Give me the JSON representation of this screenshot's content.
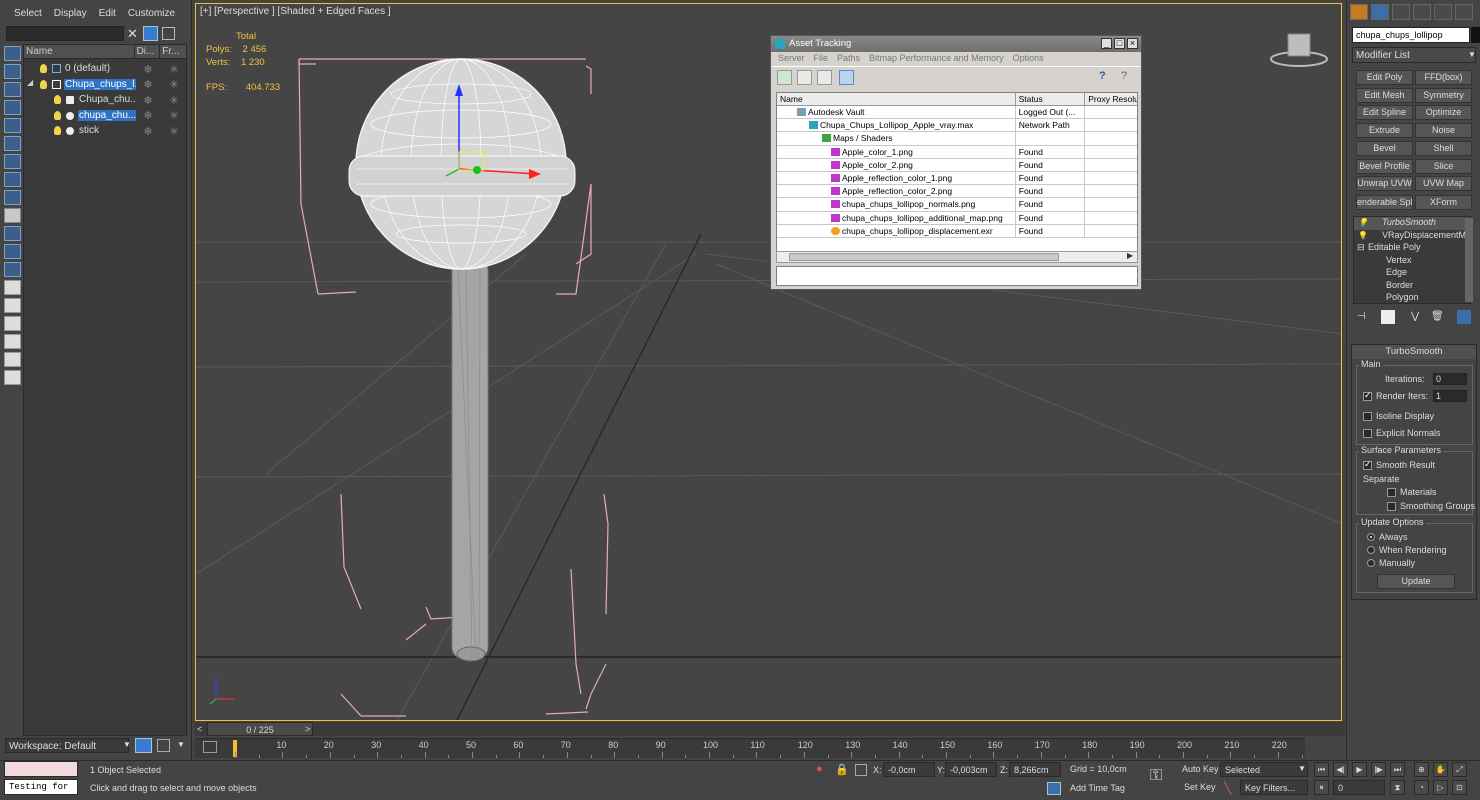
{
  "explorer": {
    "menu": [
      "Select",
      "Display",
      "Edit",
      "Customize"
    ],
    "columns": [
      "Name",
      "Di...",
      "Fr..."
    ],
    "rows": [
      {
        "label": "0 (default)",
        "level": 0
      },
      {
        "label": "Chupa_chups_l...",
        "level": 0,
        "selected": true
      },
      {
        "label": "Chupa_chu...",
        "level": 1
      },
      {
        "label": "chupa_chu...",
        "level": 1,
        "selected": true
      },
      {
        "label": "stick",
        "level": 1
      }
    ],
    "workspace": "Workspace: Default"
  },
  "viewport": {
    "label": "[+] [Perspective ] [Shaded + Edged Faces ]",
    "stats": {
      "total_label": "Total",
      "polys_label": "Polys:",
      "polys": "2 456",
      "verts_label": "Verts:",
      "verts": "1 230",
      "fps_label": "FPS:",
      "fps": "404.733"
    }
  },
  "asset_tracking": {
    "title": "Asset Tracking",
    "menu": [
      "Server",
      "File",
      "Paths",
      "Bitmap Performance and Memory",
      "Options"
    ],
    "columns": [
      "Name",
      "Status",
      "Proxy Resolu"
    ],
    "rows": [
      {
        "name": "Autodesk Vault",
        "status": "Logged Out (...",
        "icon": "vault-icon",
        "indent": 1
      },
      {
        "name": "Chupa_Chups_Lollipop_Apple_vray.max",
        "status": "Network Path",
        "icon": "max-file-icon",
        "indent": 2
      },
      {
        "name": "Maps / Shaders",
        "status": "",
        "icon": "shader-icon",
        "indent": 3
      },
      {
        "name": "Apple_color_1.png",
        "status": "Found",
        "icon": "png-icon",
        "indent": 4
      },
      {
        "name": "Apple_color_2.png",
        "status": "Found",
        "icon": "png-icon",
        "indent": 4
      },
      {
        "name": "Apple_reflection_color_1.png",
        "status": "Found",
        "icon": "png-icon",
        "indent": 4
      },
      {
        "name": "Apple_reflection_color_2.png",
        "status": "Found",
        "icon": "png-icon",
        "indent": 4
      },
      {
        "name": "chupa_chups_lollipop_normals.png",
        "status": "Found",
        "icon": "png-icon",
        "indent": 4
      },
      {
        "name": "chupa_chups_lollipop_additional_map.png",
        "status": "Found",
        "icon": "png-icon",
        "indent": 4
      },
      {
        "name": "chupa_chups_lollipop_displacement.exr",
        "status": "Found",
        "icon": "exr-icon",
        "indent": 4
      }
    ]
  },
  "command_panel": {
    "object_name": "chupa_chups_lollipop",
    "modifier_list": "Modifier List",
    "buttons": [
      "Edit Poly",
      "FFD(box)",
      "Edit Mesh",
      "Symmetry",
      "Edit Spline",
      "Optimize",
      "Extrude",
      "Noise",
      "Bevel",
      "Shell",
      "Bevel Profile",
      "Slice",
      "Unwrap UVW",
      "UVW Map",
      "enderable Splin",
      "XForm"
    ],
    "stack": [
      "TurboSmooth",
      "VRayDisplacementMo",
      "Editable Poly",
      "Vertex",
      "Edge",
      "Border",
      "Polygon"
    ],
    "turbosmooth": {
      "title": "TurboSmooth",
      "main": "Main",
      "iterations_label": "Iterations:",
      "iterations": "0",
      "render_iters_label": "Render Iters:",
      "render_iters": "1",
      "isoline": "Isoline Display",
      "explicit": "Explicit Normals",
      "surface": "Surface Parameters",
      "smooth_result": "Smooth Result",
      "separate": "Separate",
      "materials": "Materials",
      "smoothing_groups": "Smoothing Groups",
      "update_options": "Update Options",
      "always": "Always",
      "when_rendering": "When Rendering",
      "manually": "Manually",
      "update": "Update"
    }
  },
  "timeline": {
    "frame": "0 / 225",
    "ticks": [
      "10",
      "20",
      "30",
      "40",
      "50",
      "60",
      "70",
      "80",
      "90",
      "100",
      "110",
      "120",
      "130",
      "140",
      "150",
      "160",
      "170",
      "180",
      "190",
      "200",
      "210",
      "220"
    ]
  },
  "status": {
    "script": "Testing for",
    "selected": "1 Object Selected",
    "hint": "Click and drag to select and move objects",
    "x_label": "X:",
    "x": "-0,0cm",
    "y_label": "Y:",
    "y": "-0,003cm",
    "z_label": "Z:",
    "z": "8,266cm",
    "grid": "Grid = 10,0cm",
    "add_time_tag": "Add Time Tag",
    "auto_key": "Auto Key",
    "selected_set": "Selected",
    "set_key": "Set Key",
    "key_filters": "Key Filters...",
    "frame_field": "0"
  }
}
